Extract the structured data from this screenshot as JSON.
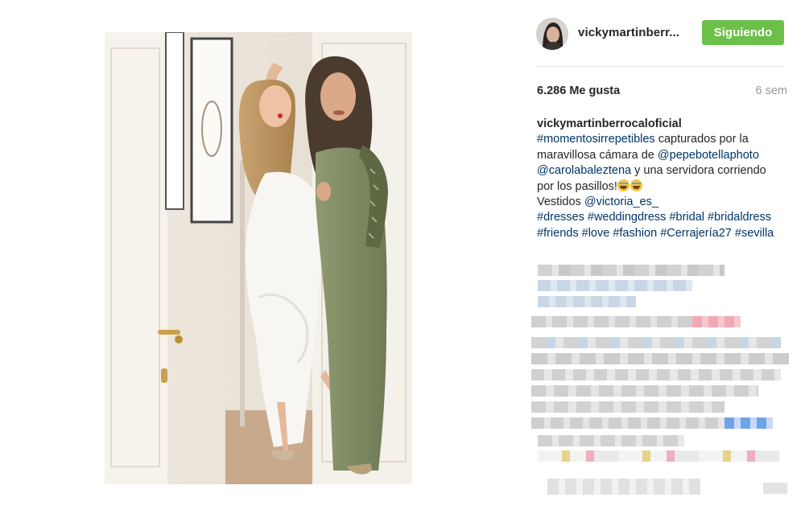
{
  "post": {
    "photo_alt": ""
  },
  "header": {
    "username": "vickymartinberr...",
    "follow_label": "Siguiendo"
  },
  "stats": {
    "likes": "6.286 Me gusta",
    "time": "6 sem"
  },
  "caption": {
    "user": "vickymartinberrocaloficial",
    "tag1": "#momentosirrepetibles",
    "t1": " capturados por la maravillosa cámara de ",
    "mention1": "@pepebotellaphoto",
    "mention2": "@carolabaleztena",
    "t2": " y una servidora corriendo por los pasillos!",
    "t3": "Vestidos ",
    "mention3": "@victoria_es_",
    "tags": [
      "#dresses",
      "#weddingdress",
      "#bridal",
      "#bridaldress",
      "#friends",
      "#love",
      "#fashion",
      "#Cerrajería27",
      "#sevilla"
    ]
  },
  "colors": {
    "follow_green": "#6cc04a",
    "link_blue": "#003569",
    "muted": "#999999"
  },
  "icons": {
    "emoji": "face-with-tears-of-joy-icon"
  }
}
